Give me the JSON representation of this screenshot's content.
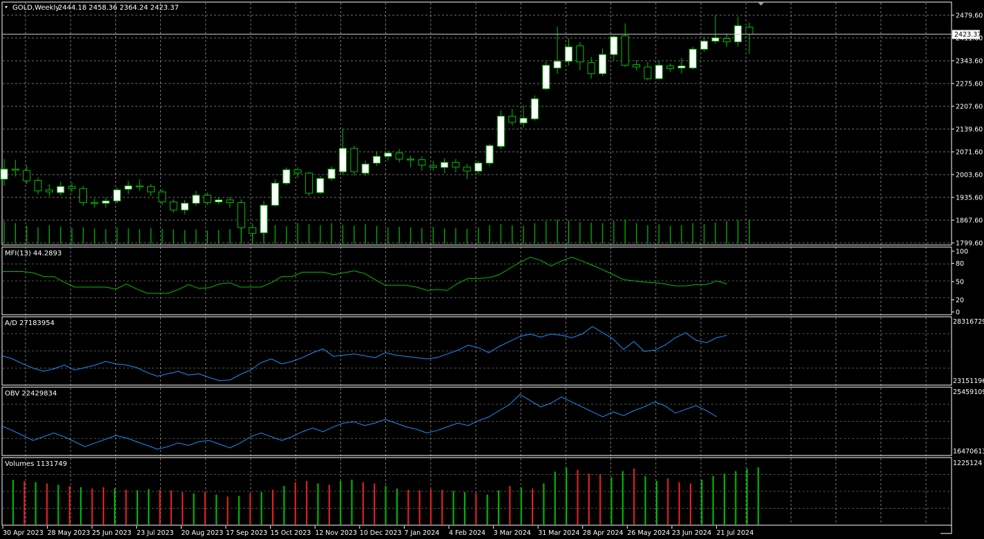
{
  "window": {
    "symbol_label": "GOLD,Weekly",
    "ohlc_text": "2444.18 2458.36 2364.24 2423.37",
    "current_price_tag": "2423.37"
  },
  "colors": {
    "background": "#000000",
    "grid": "#c8c8c8",
    "bull_candle": "#ffffff",
    "candle_outline": "#00c000",
    "mfi_line": "#00c000",
    "ad_line": "#1e90ff",
    "obv_line": "#1e90ff",
    "volume_up": "#00b400",
    "volume_down": "#e02020"
  },
  "indicators": {
    "mfi_label": "MFI(13) 44.2893",
    "ad_label": "A/D 27183954",
    "obv_label": "OBV 22429834",
    "volumes_label": "Volumes 1131749"
  },
  "chart_data": [
    {
      "type": "candlestick",
      "panel": "price",
      "y_ticks": [
        "2479.60",
        "2411.60",
        "2343.60",
        "2275.60",
        "2207.60",
        "2139.60",
        "2071.60",
        "2003.60",
        "1935.60",
        "1867.60",
        "1799.60"
      ],
      "ylim": [
        1799.6,
        2479.6
      ],
      "x_tick_labels": [
        "30 Apr 2023",
        "28 May 2023",
        "25 Jun 2023",
        "23 Jul 2023",
        "20 Aug 2023",
        "17 Sep 2023",
        "15 Oct 2023",
        "12 Nov 2023",
        "10 Dec 2023",
        "7 Jan 2024",
        "4 Feb 2024",
        "3 Mar 2024",
        "31 Mar 2024",
        "28 Apr 2024",
        "26 May 2024",
        "23 Jun 2024",
        "21 Jul 2024"
      ],
      "x_tick_index": [
        0,
        4,
        8,
        12,
        16,
        20,
        24,
        28,
        32,
        36,
        40,
        44,
        48,
        52,
        56,
        60,
        64
      ],
      "candles": [
        [
          1990,
          2020,
          1970,
          2050
        ],
        [
          2020,
          2018,
          1998,
          2048
        ],
        [
          2016,
          1985,
          1975,
          2030
        ],
        [
          1986,
          1955,
          1945,
          1995
        ],
        [
          1958,
          1952,
          1940,
          1975
        ],
        [
          1950,
          1968,
          1942,
          1982
        ],
        [
          1968,
          1962,
          1950,
          1980
        ],
        [
          1962,
          1920,
          1910,
          1970
        ],
        [
          1920,
          1918,
          1905,
          1932
        ],
        [
          1918,
          1925,
          1905,
          1935
        ],
        [
          1925,
          1958,
          1918,
          1965
        ],
        [
          1960,
          1970,
          1945,
          1985
        ],
        [
          1970,
          1968,
          1955,
          1990
        ],
        [
          1968,
          1952,
          1940,
          1975
        ],
        [
          1952,
          1922,
          1912,
          1960
        ],
        [
          1922,
          1898,
          1890,
          1930
        ],
        [
          1898,
          1918,
          1885,
          1928
        ],
        [
          1918,
          1942,
          1910,
          1955
        ],
        [
          1942,
          1920,
          1912,
          1950
        ],
        [
          1922,
          1928,
          1915,
          1935
        ],
        [
          1928,
          1920,
          1905,
          1938
        ],
        [
          1920,
          1845,
          1832,
          1930
        ],
        [
          1845,
          1828,
          1818,
          1858
        ],
        [
          1830,
          1912,
          1825,
          1925
        ],
        [
          1912,
          1978,
          1908,
          1990
        ],
        [
          1978,
          2018,
          1972,
          2025
        ],
        [
          2018,
          2008,
          1995,
          2025
        ],
        [
          2008,
          1948,
          1940,
          2012
        ],
        [
          1950,
          1992,
          1945,
          2000
        ],
        [
          1992,
          2020,
          1985,
          2028
        ],
        [
          2012,
          2082,
          2005,
          2140
        ],
        [
          2082,
          2012,
          2000,
          2090
        ],
        [
          2008,
          2035,
          2000,
          2045
        ],
        [
          2038,
          2058,
          2030,
          2072
        ],
        [
          2058,
          2068,
          2045,
          2075
        ],
        [
          2068,
          2050,
          2040,
          2080
        ],
        [
          2050,
          2048,
          2025,
          2060
        ],
        [
          2048,
          2032,
          2015,
          2058
        ],
        [
          2030,
          2025,
          2015,
          2045
        ],
        [
          2025,
          2040,
          2008,
          2052
        ],
        [
          2040,
          2026,
          2010,
          2050
        ],
        [
          2026,
          2014,
          1990,
          2035
        ],
        [
          2014,
          2038,
          2005,
          2045
        ],
        [
          2038,
          2090,
          2030,
          2095
        ],
        [
          2088,
          2178,
          2080,
          2195
        ],
        [
          2178,
          2160,
          2150,
          2200
        ],
        [
          2158,
          2172,
          2145,
          2210
        ],
        [
          2170,
          2230,
          2165,
          2240
        ],
        [
          2260,
          2330,
          2255,
          2340
        ],
        [
          2322,
          2342,
          2305,
          2445
        ],
        [
          2342,
          2385,
          2330,
          2410
        ],
        [
          2388,
          2340,
          2315,
          2400
        ],
        [
          2338,
          2305,
          2290,
          2355
        ],
        [
          2305,
          2362,
          2298,
          2380
        ],
        [
          2362,
          2415,
          2345,
          2420
        ],
        [
          2418,
          2330,
          2325,
          2455
        ],
        [
          2332,
          2325,
          2315,
          2345
        ],
        [
          2325,
          2290,
          2285,
          2340
        ],
        [
          2290,
          2330,
          2288,
          2345
        ],
        [
          2328,
          2320,
          2310,
          2335
        ],
        [
          2322,
          2328,
          2305,
          2352
        ],
        [
          2322,
          2378,
          2318,
          2385
        ],
        [
          2378,
          2402,
          2370,
          2415
        ],
        [
          2402,
          2412,
          2395,
          2480
        ],
        [
          2410,
          2400,
          2385,
          2425
        ],
        [
          2400,
          2448,
          2385,
          2475
        ],
        [
          2444,
          2423,
          2364,
          2458
        ]
      ],
      "volume_overlay": [
        0.85,
        0.78,
        0.68,
        0.62,
        0.7,
        0.65,
        0.6,
        0.62,
        0.58,
        0.55,
        0.6,
        0.58,
        0.55,
        0.6,
        0.57,
        0.55,
        0.52,
        0.55,
        0.5,
        0.52,
        0.55,
        0.68,
        0.62,
        0.72,
        0.7,
        0.66,
        0.78,
        0.74,
        0.7,
        0.78,
        0.72,
        0.68,
        0.74,
        0.67,
        0.62,
        0.64,
        0.62,
        0.6,
        0.64,
        0.58,
        0.6,
        0.57,
        0.62,
        0.7,
        0.74,
        0.7,
        0.68,
        0.78,
        0.85,
        0.92,
        0.88,
        0.82,
        0.8,
        0.78,
        0.86,
        0.92,
        0.78,
        0.7,
        0.74,
        0.68,
        0.7,
        0.78,
        0.74,
        0.8,
        0.86,
        0.9,
        0.92
      ]
    },
    {
      "type": "line",
      "panel": "mfi",
      "name": "MFI(13) 44.2893",
      "ylim": [
        0,
        100
      ],
      "y_ticks": [
        100,
        80,
        50,
        20,
        0
      ],
      "values": [
        65,
        65,
        65,
        63,
        57,
        57,
        48,
        40,
        40,
        40,
        40,
        37,
        45,
        37,
        30,
        30,
        30,
        36,
        44,
        38,
        39,
        45,
        47,
        40,
        40,
        40,
        47,
        57,
        57,
        64,
        64,
        64,
        60,
        63,
        66,
        62,
        52,
        43,
        43,
        43,
        40,
        35,
        36,
        35,
        46,
        54,
        54,
        55,
        60,
        70,
        80,
        88,
        83,
        74,
        82,
        88,
        82,
        75,
        68,
        60,
        52,
        50,
        48,
        47,
        45,
        42,
        42,
        44,
        44,
        50,
        45
      ]
    },
    {
      "type": "line",
      "panel": "ad",
      "name": "A/D 27183954",
      "y_ticks": [
        "28316729",
        "23151196"
      ],
      "values": [
        0.45,
        0.4,
        0.32,
        0.25,
        0.2,
        0.24,
        0.3,
        0.22,
        0.26,
        0.3,
        0.36,
        0.32,
        0.3,
        0.26,
        0.18,
        0.12,
        0.16,
        0.2,
        0.14,
        0.16,
        0.1,
        0.05,
        0.06,
        0.15,
        0.22,
        0.34,
        0.4,
        0.32,
        0.36,
        0.42,
        0.5,
        0.56,
        0.44,
        0.46,
        0.48,
        0.45,
        0.42,
        0.5,
        0.46,
        0.44,
        0.42,
        0.4,
        0.42,
        0.48,
        0.54,
        0.62,
        0.58,
        0.5,
        0.6,
        0.68,
        0.76,
        0.8,
        0.75,
        0.8,
        0.78,
        0.74,
        0.8,
        0.92,
        0.82,
        0.72,
        0.55,
        0.68,
        0.52,
        0.54,
        0.62,
        0.74,
        0.82,
        0.7,
        0.66,
        0.74,
        0.78
      ]
    },
    {
      "type": "line",
      "panel": "obv",
      "name": "OBV 22429834",
      "y_ticks": [
        "25459109",
        "16470613"
      ],
      "values": [
        0.45,
        0.38,
        0.3,
        0.22,
        0.28,
        0.34,
        0.28,
        0.2,
        0.12,
        0.18,
        0.24,
        0.3,
        0.26,
        0.2,
        0.14,
        0.08,
        0.12,
        0.18,
        0.14,
        0.2,
        0.22,
        0.16,
        0.1,
        0.18,
        0.28,
        0.34,
        0.28,
        0.22,
        0.28,
        0.36,
        0.42,
        0.36,
        0.44,
        0.5,
        0.52,
        0.46,
        0.5,
        0.56,
        0.5,
        0.44,
        0.4,
        0.34,
        0.38,
        0.44,
        0.5,
        0.46,
        0.54,
        0.6,
        0.7,
        0.8,
        0.96,
        0.86,
        0.76,
        0.82,
        0.92,
        0.84,
        0.76,
        0.68,
        0.6,
        0.68,
        0.62,
        0.7,
        0.76,
        0.84,
        0.78,
        0.66,
        0.72,
        0.78,
        0.7,
        0.6
      ]
    },
    {
      "type": "bar",
      "panel": "volumes",
      "name": "Volumes 1131749",
      "y_ticks": [
        "1225124"
      ],
      "ylim": [
        0,
        1225124
      ],
      "bars": [
        [
          0.72,
          "up"
        ],
        [
          0.7,
          "down"
        ],
        [
          0.68,
          "up"
        ],
        [
          0.66,
          "down"
        ],
        [
          0.64,
          "up"
        ],
        [
          0.62,
          "down"
        ],
        [
          0.6,
          "up"
        ],
        [
          0.58,
          "down"
        ],
        [
          0.6,
          "down"
        ],
        [
          0.58,
          "up"
        ],
        [
          0.56,
          "down"
        ],
        [
          0.55,
          "up"
        ],
        [
          0.57,
          "up"
        ],
        [
          0.56,
          "down"
        ],
        [
          0.55,
          "down"
        ],
        [
          0.52,
          "down"
        ],
        [
          0.5,
          "up"
        ],
        [
          0.52,
          "down"
        ],
        [
          0.48,
          "up"
        ],
        [
          0.45,
          "down"
        ],
        [
          0.46,
          "up"
        ],
        [
          0.5,
          "down"
        ],
        [
          0.52,
          "up"
        ],
        [
          0.56,
          "down"
        ],
        [
          0.62,
          "up"
        ],
        [
          0.68,
          "down"
        ],
        [
          0.7,
          "down"
        ],
        [
          0.66,
          "up"
        ],
        [
          0.64,
          "down"
        ],
        [
          0.7,
          "up"
        ],
        [
          0.72,
          "up"
        ],
        [
          0.68,
          "down"
        ],
        [
          0.66,
          "down"
        ],
        [
          0.62,
          "up"
        ],
        [
          0.58,
          "up"
        ],
        [
          0.56,
          "down"
        ],
        [
          0.55,
          "down"
        ],
        [
          0.57,
          "down"
        ],
        [
          0.56,
          "down"
        ],
        [
          0.54,
          "up"
        ],
        [
          0.52,
          "up"
        ],
        [
          0.5,
          "down"
        ],
        [
          0.48,
          "up"
        ],
        [
          0.55,
          "up"
        ],
        [
          0.62,
          "down"
        ],
        [
          0.6,
          "up"
        ],
        [
          0.58,
          "down"
        ],
        [
          0.66,
          "up"
        ],
        [
          0.85,
          "up"
        ],
        [
          0.92,
          "up"
        ],
        [
          0.88,
          "down"
        ],
        [
          0.82,
          "down"
        ],
        [
          0.8,
          "down"
        ],
        [
          0.76,
          "up"
        ],
        [
          0.86,
          "up"
        ],
        [
          0.9,
          "down"
        ],
        [
          0.78,
          "up"
        ],
        [
          0.7,
          "up"
        ],
        [
          0.74,
          "down"
        ],
        [
          0.68,
          "down"
        ],
        [
          0.66,
          "down"
        ],
        [
          0.72,
          "up"
        ],
        [
          0.78,
          "up"
        ],
        [
          0.82,
          "up"
        ],
        [
          0.86,
          "up"
        ],
        [
          0.9,
          "up"
        ],
        [
          0.92,
          "up"
        ]
      ]
    }
  ]
}
